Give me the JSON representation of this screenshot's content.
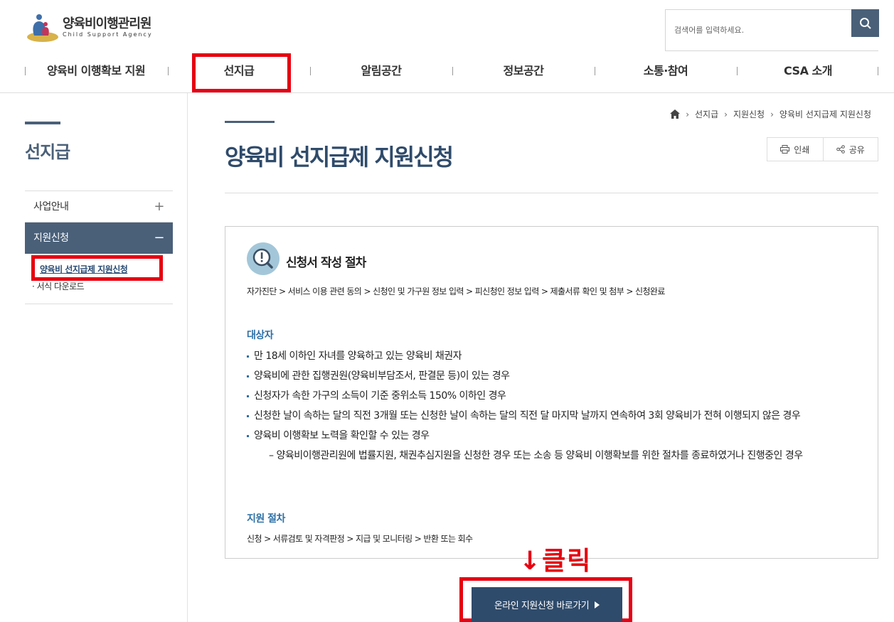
{
  "brand": {
    "name_ko": "양육비이행관리원",
    "name_en": "Child Support Agency"
  },
  "search": {
    "placeholder": "검색어를 입력하세요."
  },
  "gnb": [
    "양육비 이행확보 지원",
    "선지급",
    "알림공간",
    "정보공간",
    "소통·참여",
    "CSA 소개"
  ],
  "sidebar": {
    "title": "선지급",
    "items": [
      {
        "label": "사업안내",
        "sign": "+"
      },
      {
        "label": "지원신청",
        "sign": "−"
      }
    ],
    "sub": [
      "양육비 선지급제 지원신청",
      "· 서식 다운로드"
    ]
  },
  "breadcrumb": [
    "선지급",
    "지원신청",
    "양육비 선지급제 지원신청"
  ],
  "page": {
    "title": "양육비 선지급제 지원신청"
  },
  "util": {
    "print": "인쇄",
    "share": "공유"
  },
  "box": {
    "heading": "신청서 작성 절차",
    "steps": "자가진단 > 서비스 이용 관련 동의 > 신청인 및 가구원 정보 입력 > 피신청인 정보 입력 > 제출서류 확인 및 첨부 > 신청완료",
    "target_title": "대상자",
    "targets": [
      "만 18세 이하인 자녀를 양육하고 있는 양육비 채권자",
      "양육비에 관한 집행권원(양육비부담조서, 판결문 등)이 있는 경우",
      "신청자가 속한 가구의 소득이 기준 중위소득 150% 이하인 경우",
      "신청한 날이 속하는 달의 직전 3개월 또는 신청한 날이 속하는 달의 직전 달 마지막 날까지 연속하여 3회 양육비가 전혀 이행되지 않은 경우",
      "양육비 이행확보 노력을 확인할 수 있는 경우"
    ],
    "sub_target": "– 양육비이행관리원에 법률지원, 채권추심지원을 신청한 경우 또는 소송 등 양육비 이행확보를 위한 절차를 종료하였거나 진행중인 경우",
    "proc_title": "지원 절차",
    "proc_steps": "신청 > 서류검토 및 자격판정 > 지급 및 모니터링 > 반환 또는 회수"
  },
  "annotation": {
    "click": "↓클릭"
  },
  "apply_button": {
    "label": "온라인 지원신청 바로가기"
  },
  "colors": {
    "accent": "#4a6079",
    "title": "#2f4b6b",
    "highlight": "#e60012",
    "section": "#2d6fa6"
  }
}
